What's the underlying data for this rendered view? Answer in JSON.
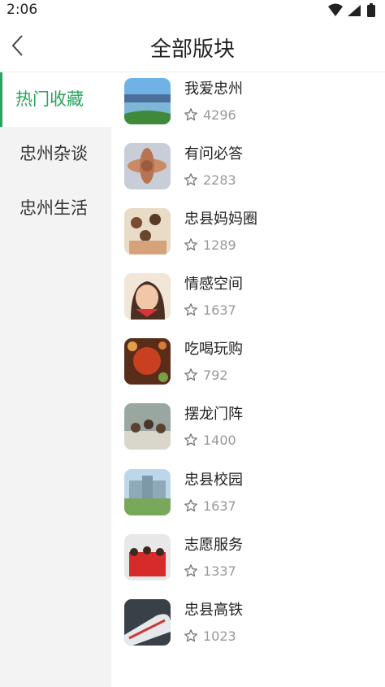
{
  "status": {
    "time": "2:06"
  },
  "header": {
    "title": "全部版块"
  },
  "sidebar": {
    "items": [
      {
        "label": "热门收藏"
      },
      {
        "label": "忠州杂谈"
      },
      {
        "label": "忠州生活"
      }
    ]
  },
  "boards": [
    {
      "name": "我爱忠州",
      "count": "4296"
    },
    {
      "name": "有问必答",
      "count": "2283"
    },
    {
      "name": "忠县妈妈圈",
      "count": "1289"
    },
    {
      "name": "情感空间",
      "count": "1637"
    },
    {
      "name": "吃喝玩购",
      "count": "792"
    },
    {
      "name": "摆龙门阵",
      "count": "1400"
    },
    {
      "name": "忠县校园",
      "count": "1637"
    },
    {
      "name": "志愿服务",
      "count": "1337"
    },
    {
      "name": "忠县高铁",
      "count": "1023"
    }
  ]
}
